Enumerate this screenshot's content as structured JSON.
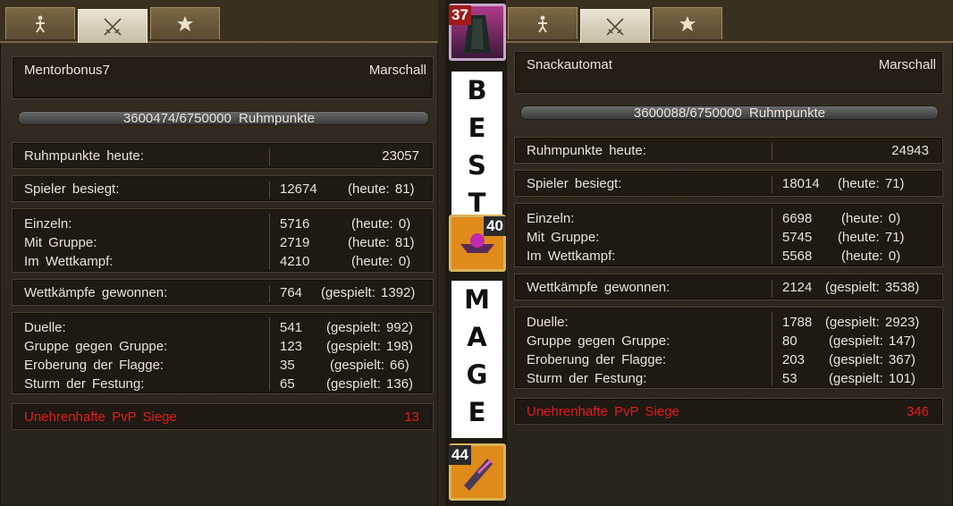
{
  "left": {
    "name": "Mentorbonus7",
    "rank": "Marschall",
    "progress": {
      "text": "3600474/6750000 Ruhmpunkte",
      "fraction": 0.533
    },
    "fame_today": {
      "label": "Ruhmpunkte heute:",
      "value": "23057"
    },
    "players_defeated": {
      "label": "Spieler besiegt:",
      "value": "12674",
      "extra": "(heute: 81)"
    },
    "kills": [
      {
        "label": "Einzeln:",
        "value": "5716",
        "extra": "(heute: 0)"
      },
      {
        "label": "Mit Gruppe:",
        "value": "2719",
        "extra": "(heute: 81)"
      },
      {
        "label": "Im Wettkampf:",
        "value": "4210",
        "extra": "(heute: 0)"
      }
    ],
    "matches_won": {
      "label": "Wettkämpfe gewonnen:",
      "value": "764",
      "extra": "(gespielt: 1392)"
    },
    "modes": [
      {
        "label": "Duelle:",
        "value": "541",
        "extra": "(gespielt: 992)"
      },
      {
        "label": "Gruppe gegen Gruppe:",
        "value": "123",
        "extra": "(gespielt: 198)"
      },
      {
        "label": "Eroberung der Flagge:",
        "value": "35",
        "extra": "(gespielt: 66)"
      },
      {
        "label": "Sturm der Festung:",
        "value": "65",
        "extra": "(gespielt: 136)"
      }
    ],
    "dishonorable": {
      "label": "Unehrenhafte PvP Siege",
      "value": "13"
    }
  },
  "right": {
    "name": "Snackautomat",
    "rank": "Marschall",
    "progress": {
      "text": "3600088/6750000 Ruhmpunkte",
      "fraction": 0.533
    },
    "fame_today": {
      "label": "Ruhmpunkte heute:",
      "value": "24943"
    },
    "players_defeated": {
      "label": "Spieler besiegt:",
      "value": "18014",
      "extra": "(heute: 71)"
    },
    "kills": [
      {
        "label": "Einzeln:",
        "value": "6698",
        "extra": "(heute: 0)"
      },
      {
        "label": "Mit Gruppe:",
        "value": "5745",
        "extra": "(heute: 71)"
      },
      {
        "label": "Im Wettkampf:",
        "value": "5568",
        "extra": "(heute: 0)"
      }
    ],
    "matches_won": {
      "label": "Wettkämpfe gewonnen:",
      "value": "2124",
      "extra": "(gespielt: 3538)"
    },
    "modes": [
      {
        "label": "Duelle:",
        "value": "1788",
        "extra": "(gespielt: 2923)"
      },
      {
        "label": "Gruppe gegen Gruppe:",
        "value": "80",
        "extra": "(gespielt: 147)"
      },
      {
        "label": "Eroberung der Flagge:",
        "value": "203",
        "extra": "(gespielt: 367)"
      },
      {
        "label": "Sturm der Festung:",
        "value": "53",
        "extra": "(gespielt: 101)"
      }
    ],
    "dishonorable": {
      "label": "Unehrenhafte PvP Siege",
      "value": "346"
    }
  },
  "center": {
    "word1": [
      "B",
      "E",
      "S",
      "T"
    ],
    "word2": [
      "M",
      "A",
      "G",
      "E"
    ],
    "skills": [
      {
        "icon": "cloak-icon",
        "badge": "37",
        "badge_color": "#a11a1a"
      },
      {
        "icon": "anvil-icon",
        "badge": "40",
        "badge_color": "#2a2a2a"
      },
      {
        "icon": "scroll-icon",
        "badge": "44",
        "badge_color": "#2a2a2a"
      }
    ]
  },
  "tabs": [
    {
      "icon": "person-icon",
      "active": false
    },
    {
      "icon": "crossed-swords-icon",
      "active": true
    },
    {
      "icon": "medal-icon",
      "active": false
    }
  ]
}
